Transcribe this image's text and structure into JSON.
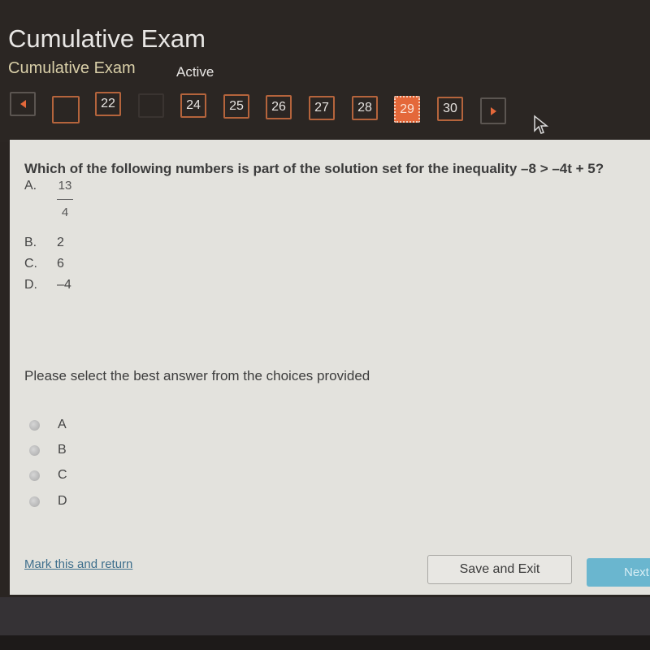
{
  "header": {
    "title": "Cumulative Exam",
    "subtitle": "Cumulative Exam",
    "status": "Active"
  },
  "question_nav": {
    "prev_icon": "left-arrow-icon",
    "next_icon": "right-arrow-icon",
    "items": [
      {
        "label": "",
        "state": "default"
      },
      {
        "label": "22",
        "state": "default"
      },
      {
        "label": "",
        "state": "hidden"
      },
      {
        "label": "24",
        "state": "default"
      },
      {
        "label": "25",
        "state": "default"
      },
      {
        "label": "26",
        "state": "default"
      },
      {
        "label": "27",
        "state": "default"
      },
      {
        "label": "28",
        "state": "default"
      },
      {
        "label": "29",
        "state": "current"
      },
      {
        "label": "30",
        "state": "default"
      }
    ],
    "accent_color": "#e4683a"
  },
  "question": {
    "text": "Which of the following numbers is part of the solution set for the inequality –8 > –4t + 5?",
    "choices": [
      {
        "letter": "A.",
        "numerator": "13",
        "denominator": "4"
      },
      {
        "letter": "B.",
        "value": "2"
      },
      {
        "letter": "C.",
        "value": "6"
      },
      {
        "letter": "D.",
        "value": "–4"
      }
    ]
  },
  "answer": {
    "prompt": "Please select the best answer from the choices provided",
    "options": [
      "A",
      "B",
      "C",
      "D"
    ],
    "selected": null
  },
  "footer": {
    "mark_link": "Mark this and return",
    "save_button": "Save and Exit",
    "next_button": "Next",
    "next_color": "#6ab6cf"
  }
}
